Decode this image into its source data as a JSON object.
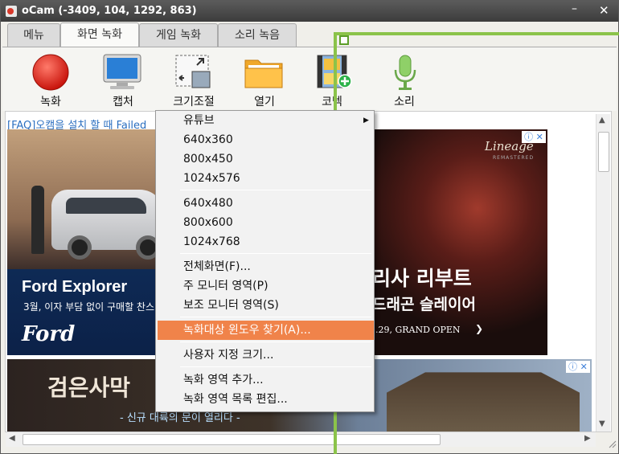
{
  "window": {
    "title": "oCam (-3409, 104, 1292, 863)",
    "minimize": "–",
    "close": "✕"
  },
  "tabs": [
    {
      "label": "메뉴"
    },
    {
      "label": "화면 녹화"
    },
    {
      "label": "게임 녹화"
    },
    {
      "label": "소리 녹음"
    }
  ],
  "toolbar": {
    "record": "녹화",
    "capture": "캡처",
    "resize": "크기조절",
    "open": "열기",
    "codec": "코덱",
    "sound": "소리"
  },
  "content": {
    "faq_link": "[FAQ]오캠을 설치 할 때 Failed",
    "ad1": {
      "headline": "Ford Explorer",
      "sub": "3월, 이자 부담 없이 구매할 찬스",
      "logo": "Ford"
    },
    "ad2": {
      "brand": "Lineage",
      "remastered": "REMASTERED",
      "line1": "리사 리부트",
      "line2": "드래곤 슬레이어",
      "date": ".29, GRAND OPEN",
      "arrow": "❯"
    },
    "ad3": {
      "headline": "검은사막",
      "sub": "- 신규 대륙의 문이 열리다 -"
    },
    "ad_badge": "ⓘ ✕"
  },
  "menu": {
    "items": [
      {
        "label": "유튜브",
        "arrow": "▶"
      },
      {
        "label": "640x360"
      },
      {
        "label": "800x450"
      },
      {
        "label": "1024x576"
      },
      {
        "label": "640x480"
      },
      {
        "label": "800x600"
      },
      {
        "label": "1024x768"
      },
      {
        "label": "전체화면(F)..."
      },
      {
        "label": "주 모니터 영역(P)"
      },
      {
        "label": "보조 모니터 영역(S)"
      },
      {
        "label": "녹화대상 윈도우 찾기(A)..."
      },
      {
        "label": "사용자 지정 크기..."
      },
      {
        "label": "녹화 영역 추가..."
      },
      {
        "label": "녹화 영역 목록 편집..."
      }
    ]
  },
  "scroll": {
    "up": "▲",
    "down": "▼",
    "left": "◀",
    "right": "▶"
  },
  "colors": {
    "highlight": "#f0834a",
    "recording_frame": "#8bc34a",
    "link": "#2b6fc0"
  }
}
